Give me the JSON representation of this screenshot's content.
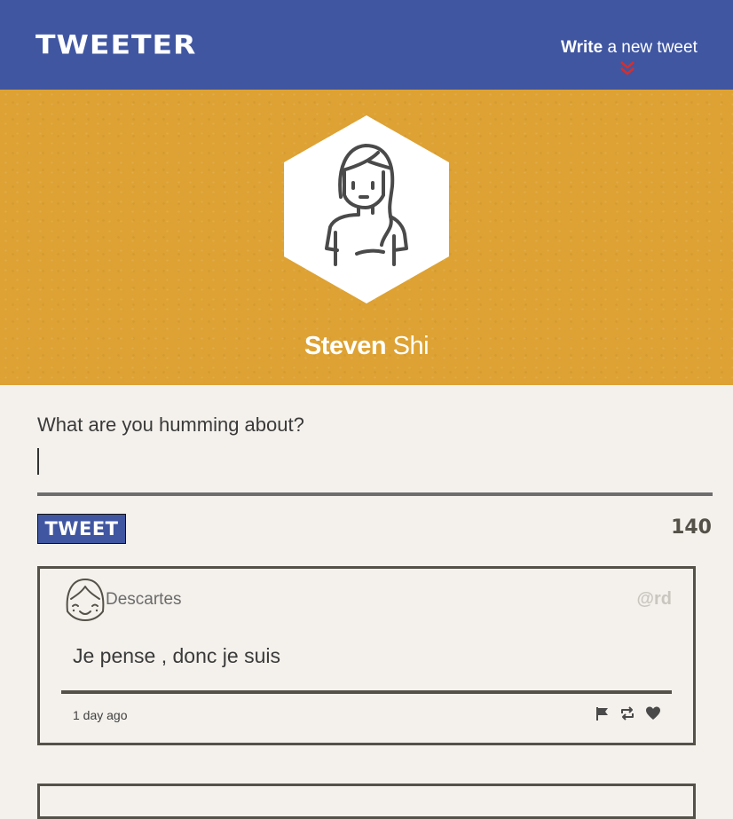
{
  "nav": {
    "brand": "TWEETER",
    "compose_bold": "Write",
    "compose_rest": " a new tweet",
    "colors": {
      "bar": "#4056a1",
      "chevron": "#d62e2e"
    },
    "icons": {
      "toggle": "double-chevron-down-icon"
    }
  },
  "profile": {
    "first_name": "Steven",
    "last_name": " Shi",
    "avatar_icon": "girl-avatar-icon",
    "background_color": "#dda233"
  },
  "compose": {
    "label": "What are you humming about?",
    "value": "",
    "button_label": "TWEET",
    "counter": "140"
  },
  "tweets": [
    {
      "author": "Descartes",
      "handle": "@rd",
      "text": "Je pense , donc je suis",
      "time": "1 day ago",
      "avatar_icon": "smiling-girl-avatar-icon",
      "actions": [
        "flag-icon",
        "retweet-icon",
        "heart-icon"
      ]
    }
  ]
}
